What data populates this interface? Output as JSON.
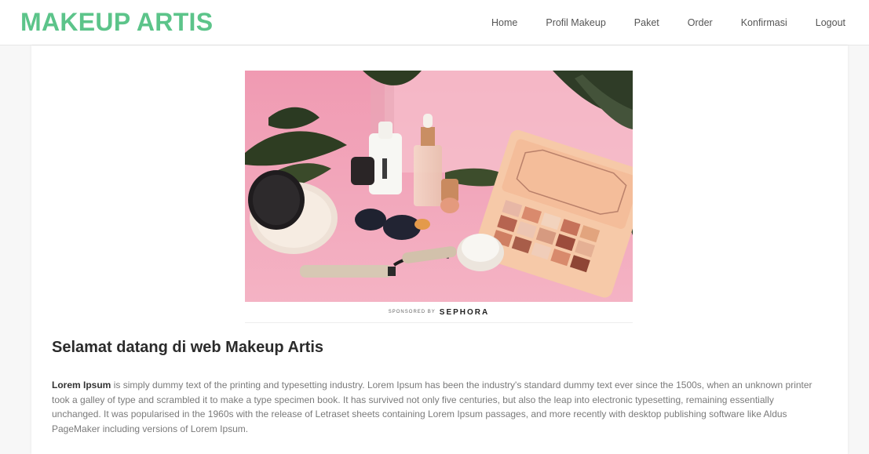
{
  "nav": {
    "brand": "MAKEUP ARTIS",
    "links": [
      "Home",
      "Profil Makeup",
      "Paket",
      "Order",
      "Konfirmasi",
      "Logout"
    ]
  },
  "hero": {
    "sponsor_prefix": "SPONSORED BY",
    "sponsor_brand": "SEPHORA"
  },
  "main": {
    "title": "Selamat datang di web Makeup Artis",
    "lead": "Lorem Ipsum",
    "body": " is simply dummy text of the printing and typesetting industry. Lorem Ipsum has been the industry's standard dummy text ever since the 1500s, when an unknown printer took a galley of type and scrambled it to make a type specimen book. It has survived not only five centuries, but also the leap into electronic typesetting, remaining essentially unchanged. It was popularised in the 1960s with the release of Letraset sheets containing Lorem Ipsum passages, and more recently with desktop publishing software like Aldus PageMaker including versions of Lorem Ipsum."
  },
  "colors": {
    "brand": "#5cc48a",
    "hero_background": "#f3a6b9",
    "palette_case": "#f6c9a8"
  }
}
